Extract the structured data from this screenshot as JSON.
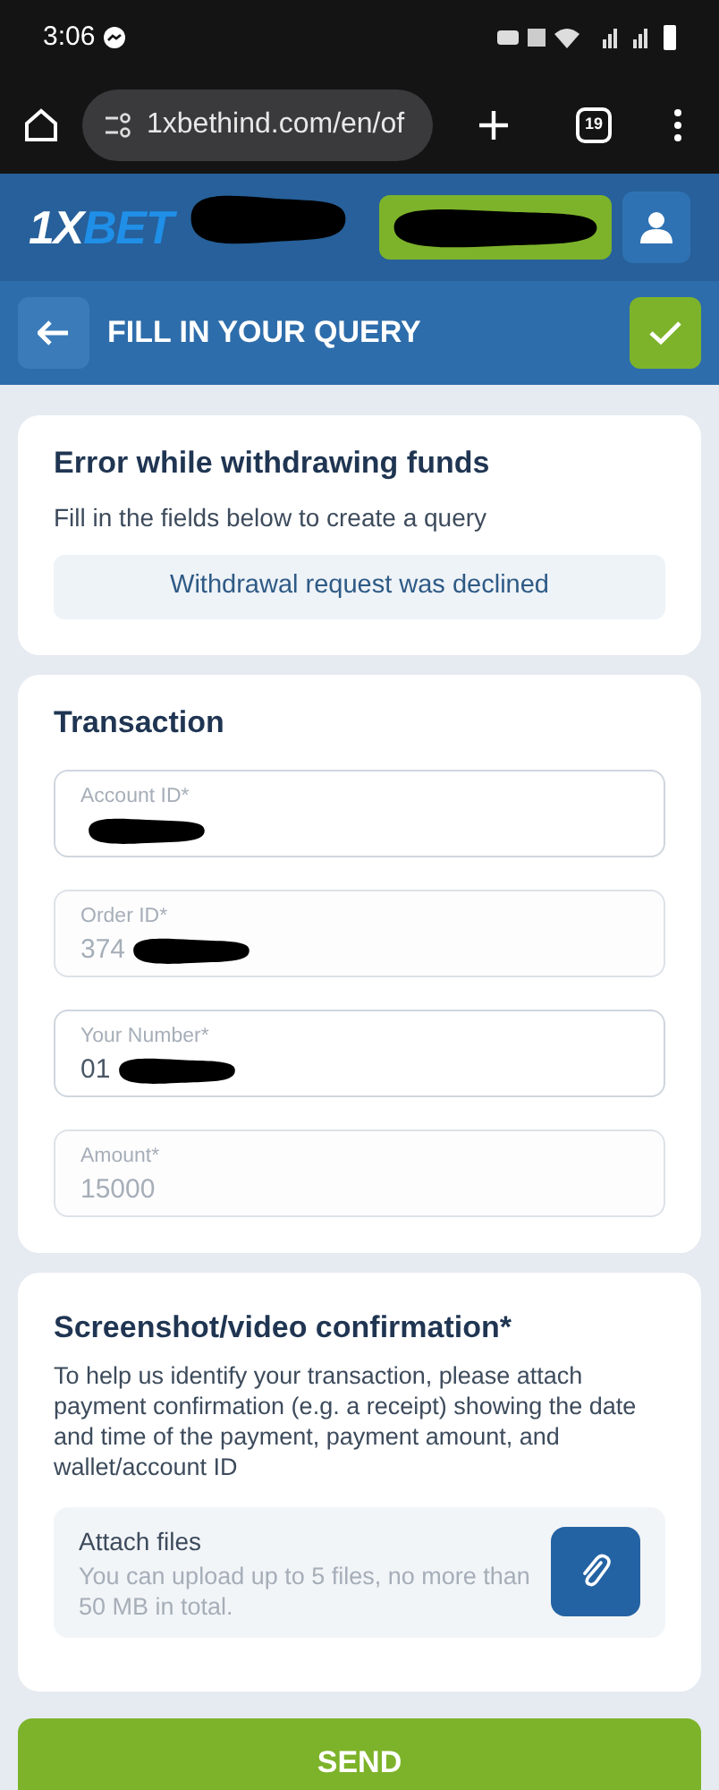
{
  "status_bar": {
    "time": "3:06"
  },
  "browser": {
    "url": "1xbethind.com/en/of",
    "tab_count": "19"
  },
  "header": {
    "logo_left": "1X",
    "logo_right": "BET"
  },
  "title_bar": {
    "title": "FILL IN YOUR QUERY"
  },
  "error_card": {
    "title": "Error while withdrawing funds",
    "subtitle": "Fill in the fields below to create a query",
    "reason": "Withdrawal request was declined"
  },
  "transaction": {
    "title": "Transaction",
    "fields": [
      {
        "label": "Account ID*",
        "redacted": true
      },
      {
        "label": "Order ID*",
        "value": "374",
        "redacted": true,
        "readonly": true
      },
      {
        "label": "Your Number*",
        "value": "01",
        "redacted": true,
        "readonly": false
      },
      {
        "label": "Amount*",
        "value": "15000",
        "redacted": false,
        "readonly": true
      }
    ]
  },
  "confirmation": {
    "title": "Screenshot/video confirmation*",
    "text": "To help us identify your transaction, please attach payment confirmation (e.g. a receipt) showing the date and time of the payment, payment amount, and wallet/account ID",
    "attach_title": "Attach files",
    "attach_hint": "You can upload up to 5 files, no more than 50 MB in total."
  },
  "send_button": "SEND"
}
